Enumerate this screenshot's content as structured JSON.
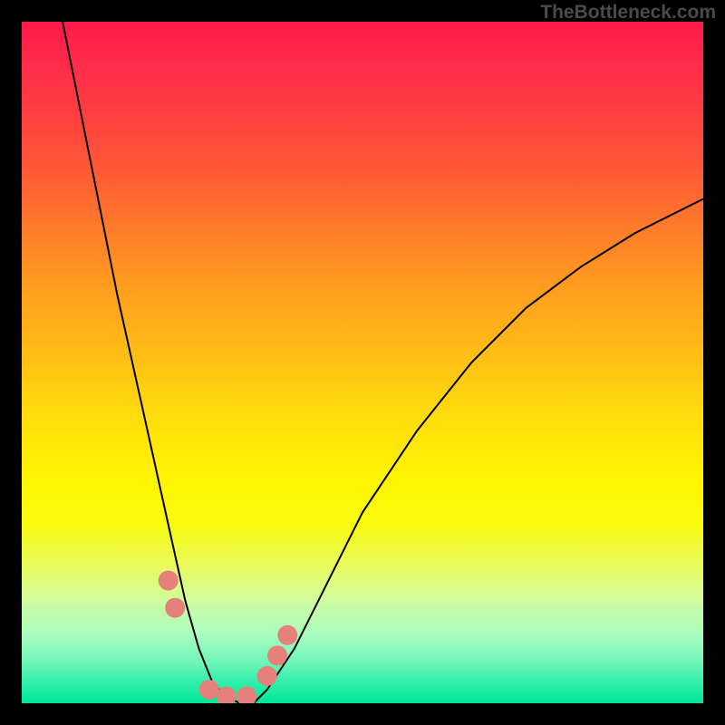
{
  "watermark": "TheBottleneck.com",
  "chart_data": {
    "type": "line",
    "title": "",
    "xlabel": "",
    "ylabel": "",
    "xlim": [
      0,
      100
    ],
    "ylim": [
      0,
      100
    ],
    "grid": false,
    "legend": false,
    "background": "rainbow-gradient-red-yellow-green",
    "series": [
      {
        "name": "bottleneck-curve",
        "color": "#000000",
        "x": [
          6,
          10,
          14,
          18,
          22,
          24,
          26,
          28,
          30,
          32,
          34,
          36,
          40,
          44,
          50,
          58,
          66,
          74,
          82,
          90,
          100
        ],
        "y": [
          100,
          80,
          60,
          42,
          24,
          15,
          8,
          3,
          1,
          0,
          0,
          2,
          8,
          16,
          28,
          40,
          50,
          58,
          64,
          69,
          74
        ]
      }
    ],
    "markers": [
      {
        "name": "curve-marker",
        "x": 21.5,
        "y": 18,
        "color": "#e5807a"
      },
      {
        "name": "curve-marker",
        "x": 22.5,
        "y": 14,
        "color": "#e5807a"
      },
      {
        "name": "curve-marker",
        "x": 27.5,
        "y": 2,
        "color": "#e5807a"
      },
      {
        "name": "curve-marker",
        "x": 30.0,
        "y": 1,
        "color": "#e5807a"
      },
      {
        "name": "curve-marker",
        "x": 33.0,
        "y": 1,
        "color": "#e5807a"
      },
      {
        "name": "curve-marker",
        "x": 36.0,
        "y": 4,
        "color": "#e5807a"
      },
      {
        "name": "curve-marker",
        "x": 37.5,
        "y": 7,
        "color": "#e5807a"
      },
      {
        "name": "curve-marker",
        "x": 39.0,
        "y": 10,
        "color": "#e5807a"
      }
    ]
  }
}
